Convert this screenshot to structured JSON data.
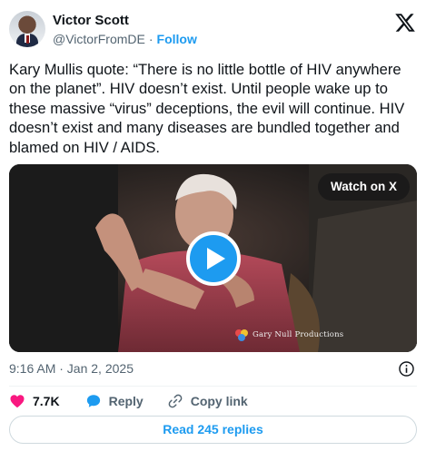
{
  "author": {
    "name": "Victor Scott",
    "handle": "@VictorFromDE",
    "separator": "·",
    "follow_label": "Follow"
  },
  "brand_icon": "x-logo-icon",
  "tweet": {
    "text": "Kary Mullis quote: “There is no little bottle of HIV anywhere on the planet”. HIV doesn’t exist. Until people wake up to these massive “virus” deceptions, the evil will continue. HIV doesn’t exist and many diseases are bundled together and blamed on HIV / AIDS."
  },
  "media": {
    "watch_label": "Watch on X",
    "watermark_text": "Gary Null Productions",
    "play_icon": "play-icon"
  },
  "meta": {
    "timestamp": "9:16 AM · Jan 2, 2025",
    "info_icon": "info-icon"
  },
  "actions": {
    "like_count": "7.7K",
    "reply_label": "Reply",
    "copy_label": "Copy link"
  },
  "read_replies_label": "Read 245 replies",
  "colors": {
    "accent": "#1d9bf0",
    "like": "#f91880",
    "text": "#0f1419",
    "secondary": "#536471",
    "border": "#cfd9de"
  }
}
